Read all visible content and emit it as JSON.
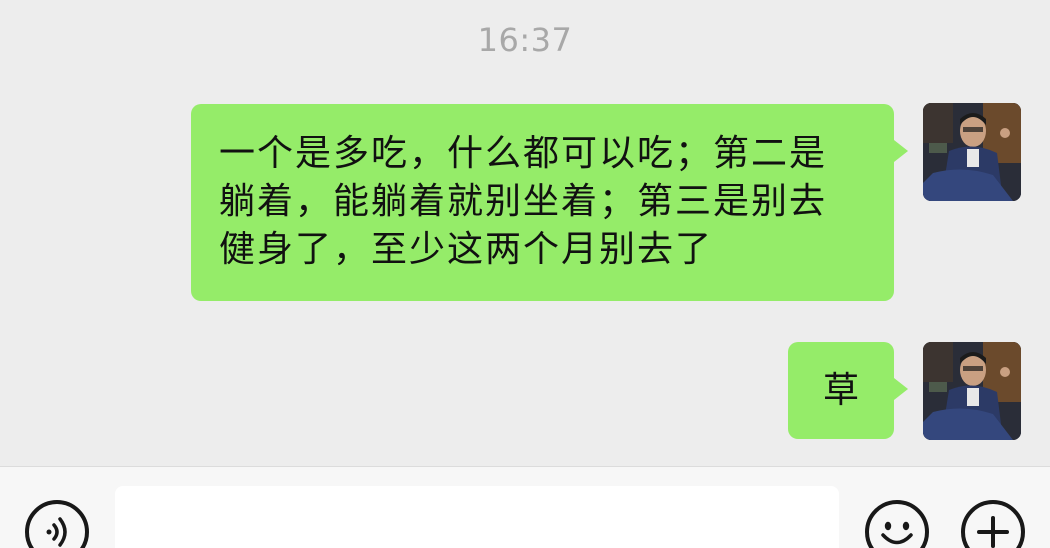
{
  "chat": {
    "timestamp": "16:37",
    "messages": [
      {
        "sender": "me",
        "lines": [
          "一个是多吃，什么都可以吃；第二是",
          "躺着，能躺着就别坐着；第三是别去",
          "健身了，至少这两个月别去了"
        ]
      },
      {
        "sender": "me",
        "text": "草"
      }
    ]
  },
  "input_bar": {
    "text_value": "",
    "icons": {
      "voice": "voice-icon",
      "emoji": "emoji-icon",
      "more": "plus-icon"
    }
  },
  "colors": {
    "background": "#ededed",
    "bubble_sent": "#95ec69",
    "timestamp_text": "#a8a8a8",
    "input_bar_bg": "#f7f7f7"
  }
}
